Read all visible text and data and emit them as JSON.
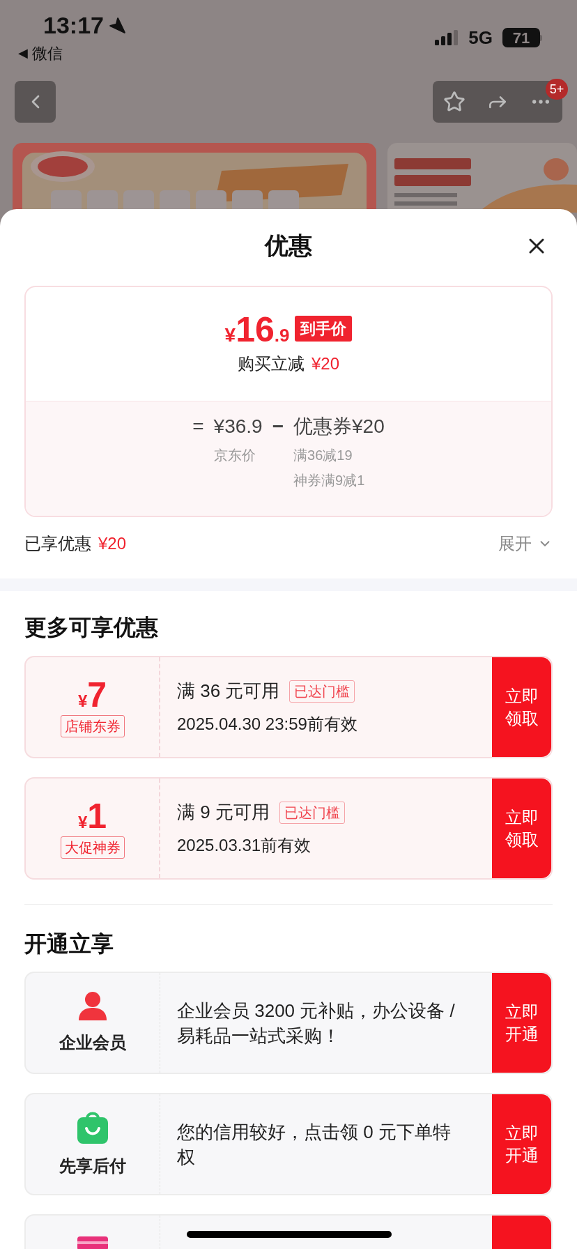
{
  "status_bar": {
    "time": "13:17",
    "back_arrow": "◀",
    "back_label": "微信",
    "network": "5G",
    "battery": "71"
  },
  "nav": {
    "badge": "5+"
  },
  "sheet": {
    "title": "优惠"
  },
  "price_card": {
    "currency": "¥",
    "integer": "16",
    "decimal": ".9",
    "tag": "到手价",
    "reduction_label": "购买立减",
    "reduction_value": "¥20",
    "equals": "=",
    "base_price": "¥36.9",
    "base_label": "京东价",
    "minus": "−",
    "coupon_total": "优惠券¥20",
    "coupon_details": [
      "满36减19",
      "神券满9减1"
    ]
  },
  "summary": {
    "label": "已享优惠",
    "value": "¥20",
    "toggle": "展开",
    "expanded": false
  },
  "more_offers": {
    "title": "更多可享优惠",
    "coupons": [
      {
        "currency": "¥",
        "amount": "7",
        "type": "店铺东券",
        "condition": "满 36 元可用",
        "badge": "已达门槛",
        "validity": "2025.04.30 23:59前有效",
        "action": "立即领取"
      },
      {
        "currency": "¥",
        "amount": "1",
        "type": "大促神券",
        "condition": "满 9 元可用",
        "badge": "已达门槛",
        "validity": "2025.03.31前有效",
        "action": "立即领取"
      }
    ]
  },
  "services": {
    "title": "开通立享",
    "items": [
      {
        "kind": "person",
        "name": "企业会员",
        "description": "企业会员 3200 元补贴，办公设备 / 易耗品一站式采购！",
        "action": "立即开通"
      },
      {
        "kind": "bag",
        "name": "先享后付",
        "description": "您的信用较好，点击领 0 元下单特权",
        "action": "立即开通"
      },
      {
        "kind": "card"
      }
    ]
  }
}
